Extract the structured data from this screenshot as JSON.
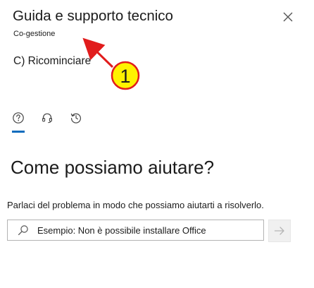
{
  "panel": {
    "title": "Guida e supporto tecnico",
    "subtitle": "Co-gestione",
    "section_label": "C) Ricominciare"
  },
  "annotation": {
    "badge_number": "1",
    "badge_color": "#fff200",
    "arrow_color": "#e11c1c"
  },
  "tabs": [
    {
      "icon": "help-circle-icon",
      "selected": true
    },
    {
      "icon": "headset-icon",
      "selected": false
    },
    {
      "icon": "history-icon",
      "selected": false
    }
  ],
  "main": {
    "heading": "Come possiamo aiutare?",
    "description": "Parlaci del problema in modo che possiamo aiutarti a risolverlo.",
    "search": {
      "value": "",
      "placeholder": "Esempio: Non è possibile installare Office"
    }
  },
  "colors": {
    "accent": "#0f6cbd",
    "text": "#1b1b1b"
  }
}
